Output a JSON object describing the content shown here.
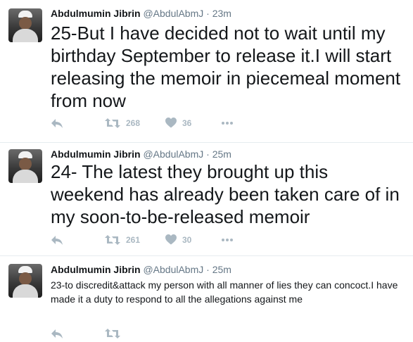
{
  "tweets": [
    {
      "name": "Abdulmumin Jibrin",
      "handle": "@AbdulAbmJ",
      "separator": "·",
      "time": "23m",
      "text": "25-But I have decided not to wait until my birthday September to release it.I will start releasing the memoir in piecemeal moment from now",
      "retweets": "268",
      "likes": "36"
    },
    {
      "name": "Abdulmumin Jibrin",
      "handle": "@AbdulAbmJ",
      "separator": "·",
      "time": "25m",
      "text": "24- The latest they brought up this weekend has already been taken care of in my soon-to-be-released memoir",
      "retweets": "261",
      "likes": "30"
    },
    {
      "name": "Abdulmumin Jibrin",
      "handle": "@AbdulAbmJ",
      "separator": "·",
      "time": "25m",
      "text": "23-to discredit&attack my person with all manner of lies they can concoct.I have made it a duty to respond to all the allegations against me",
      "retweets": "",
      "likes": ""
    }
  ],
  "icons": {
    "reply": "reply-icon",
    "retweet": "retweet-icon",
    "like": "heart-icon",
    "more": "more-icon"
  },
  "colors": {
    "text": "#14171a",
    "muted": "#657786",
    "icon": "#aab8c2",
    "divider": "#e6ecf0"
  }
}
